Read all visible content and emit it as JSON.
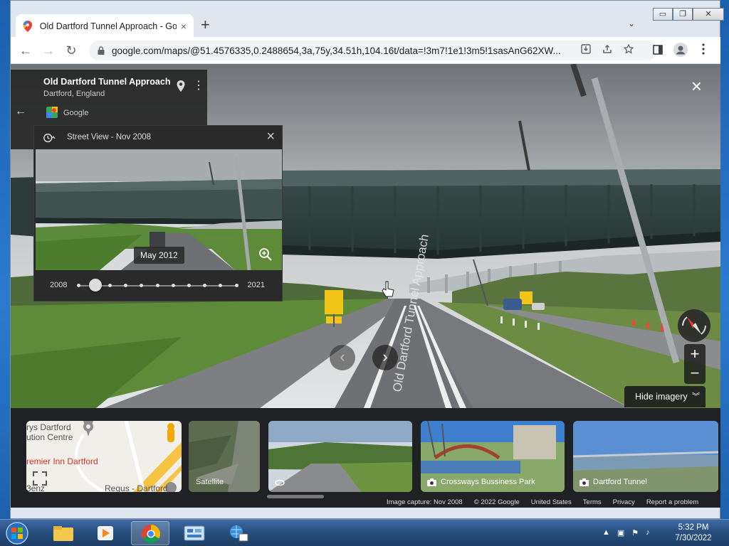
{
  "browser": {
    "tab_title": "Old Dartford Tunnel Approach - Google Maps",
    "tab_close": "×",
    "new_tab": "+",
    "tab_menu": "⌄",
    "url": "google.com/maps/@51.4576335,0.2488654,3a,75y,34.51h,104.16t/data=!3m7!1e1!3m5!1sasAnG62XW...",
    "nav": {
      "back": "←",
      "forward": "→",
      "reload": "↻"
    }
  },
  "place_card": {
    "name": "Old Dartford Tunnel Approach",
    "subtitle": "Dartford, England",
    "provider": "Google",
    "back": "←",
    "more": "⋮"
  },
  "exit": "×",
  "time_machine": {
    "title": "Street View - Nov 2008",
    "close": "×",
    "preview_date": "May 2012",
    "year_start": "2008",
    "year_end": "2021",
    "slider_position": 0.11,
    "dot_count": 11
  },
  "street_label": "Old Dartford Tunnel Approach",
  "controls": {
    "zoom_in": "+",
    "zoom_out": "−",
    "nav_prev": "‹",
    "nav_next": "›",
    "hide_imagery": "Hide imagery",
    "hide_imagery_chevron": "︾"
  },
  "strip": {
    "map_labels": [
      "rys Dartford",
      "ution Centre",
      "remier Inn Dartford",
      "Regus - Dartford",
      "3enz"
    ],
    "satellite": "Satellite",
    "photos": [
      {
        "label": "Crossways Bussiness Park"
      },
      {
        "label": "Dartford Tunnel"
      }
    ]
  },
  "footer": {
    "capture": "Image capture: Nov 2008",
    "copyright": "© 2022 Google",
    "country": "United States",
    "terms": "Terms",
    "privacy": "Privacy",
    "report": "Report a problem"
  },
  "window_controls": {
    "minimize": "▭",
    "restore": "❐",
    "close": "✕"
  },
  "taskbar": {
    "time": "5:32 PM",
    "date": "7/30/2022"
  },
  "colors": {
    "accent": "#1a73e8",
    "panel": "#202124",
    "desktop": "#1e63b5"
  }
}
